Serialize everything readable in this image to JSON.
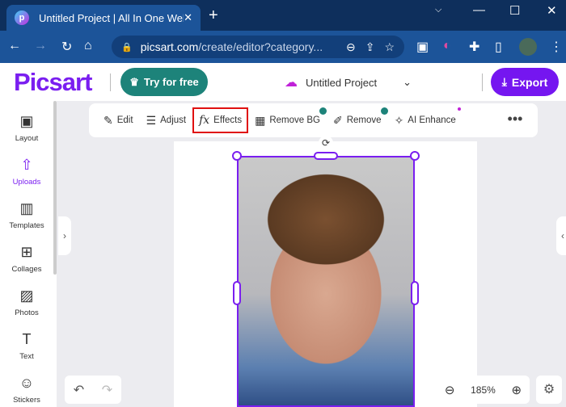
{
  "browser": {
    "tab_title": "Untitled Project | All In One Web",
    "url_host": "picsart.com",
    "url_path": "/create/editor?category..."
  },
  "header": {
    "logo": "Picsart",
    "try_label": "Try for free",
    "project_name": "Untitled Project",
    "export_label": "Export"
  },
  "sidebar": {
    "items": [
      {
        "label": "Layout",
        "icon": "▣"
      },
      {
        "label": "Uploads",
        "icon": "⇧"
      },
      {
        "label": "Templates",
        "icon": "▥"
      },
      {
        "label": "Collages",
        "icon": "⊞"
      },
      {
        "label": "Photos",
        "icon": "▨"
      },
      {
        "label": "Text",
        "icon": "T"
      },
      {
        "label": "Stickers",
        "icon": "☺"
      }
    ]
  },
  "tools": [
    {
      "label": "Edit",
      "icon": "✎"
    },
    {
      "label": "Adjust",
      "icon": "☰"
    },
    {
      "label": "Effects",
      "icon": "fx"
    },
    {
      "label": "Remove BG",
      "icon": "▦"
    },
    {
      "label": "Remove",
      "icon": "✐"
    },
    {
      "label": "AI Enhance",
      "icon": "✧"
    }
  ],
  "zoom": {
    "value": "185%"
  },
  "colors": {
    "brand": "#7a1ef0",
    "highlight": "#e01010"
  }
}
